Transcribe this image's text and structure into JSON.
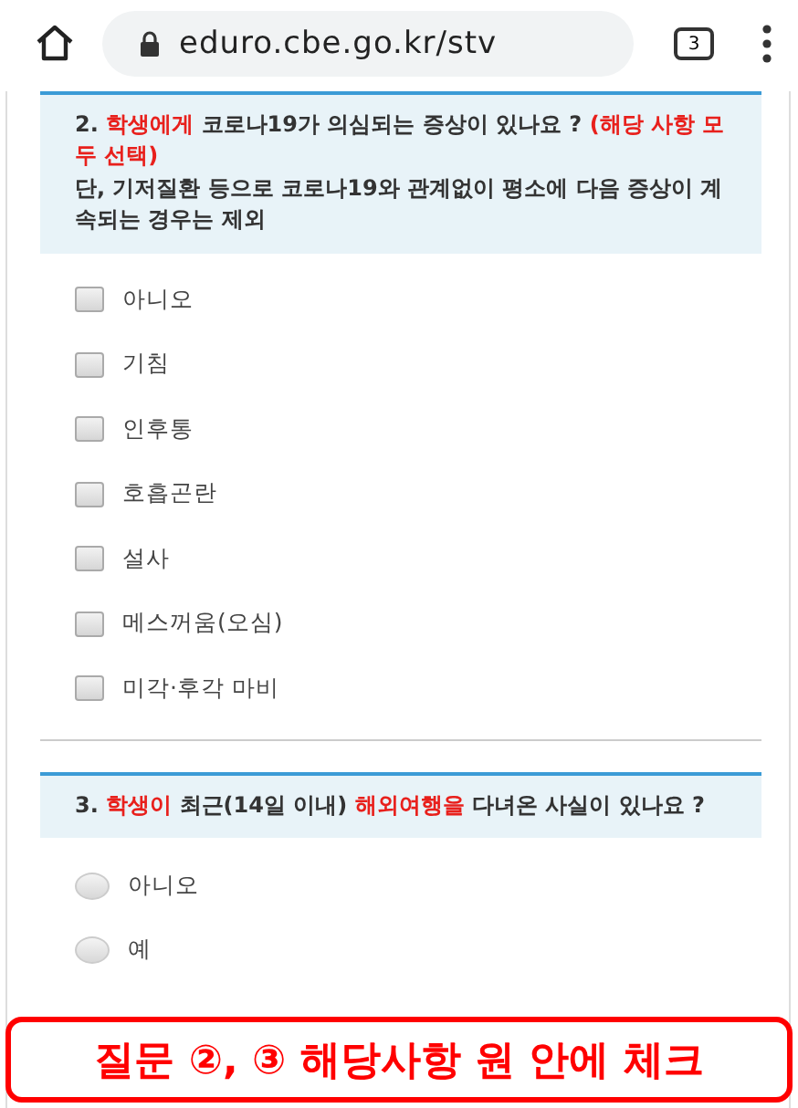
{
  "browser": {
    "url": "eduro.cbe.go.kr/stv",
    "tab_count": "3"
  },
  "questions": [
    {
      "kind": "checkbox",
      "title": [
        {
          "text": "2. ",
          "highlight": false
        },
        {
          "text": "학생에게",
          "highlight": true
        },
        {
          "text": " 코로나19가 의심되는 증상이 있나요 ? ",
          "highlight": false
        },
        {
          "text": "(해당 사항 모두 선택)",
          "highlight": true
        }
      ],
      "note": "단, 기저질환 등으로 코로나19와 관계없이 평소에 다음 증상이 계속되는 경우는 제외",
      "options": [
        {
          "label": "아니오",
          "checked": false
        },
        {
          "label": "기침",
          "checked": false
        },
        {
          "label": "인후통",
          "checked": false
        },
        {
          "label": "호흡곤란",
          "checked": false
        },
        {
          "label": "설사",
          "checked": false
        },
        {
          "label": "메스꺼움(오심)",
          "checked": false
        },
        {
          "label": "미각·후각 마비",
          "checked": false
        }
      ]
    },
    {
      "kind": "radio",
      "title": [
        {
          "text": "3. ",
          "highlight": false
        },
        {
          "text": "학생이",
          "highlight": true
        },
        {
          "text": " 최근(14일 이내) ",
          "highlight": false
        },
        {
          "text": "해외여행을",
          "highlight": true
        },
        {
          "text": " 다녀온 사실이 있나요 ?",
          "highlight": false
        }
      ],
      "options": [
        {
          "label": "아니오",
          "selected": false
        },
        {
          "label": "예",
          "selected": false
        }
      ]
    }
  ],
  "callout": "질문 ②, ③ 해당사항 원 안에 체크"
}
